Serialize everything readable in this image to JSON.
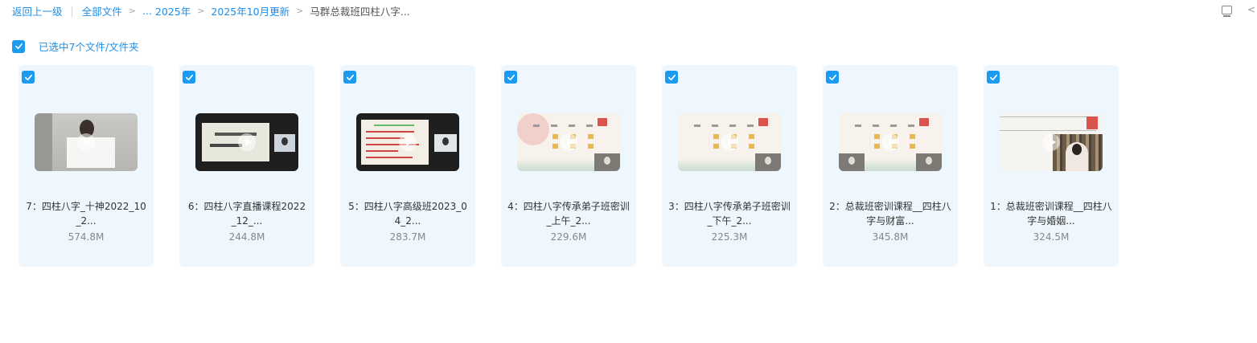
{
  "breadcrumb": {
    "back": "返回上一级",
    "all_files": "全部文件",
    "ellipsis": "...",
    "year": "2025年",
    "month": "2025年10月更新",
    "current": "马群总裁班四柱八字..."
  },
  "selection": {
    "label": "已选中7个文件/文件夹",
    "checked": true
  },
  "accent_color": "#1a9bef",
  "files": [
    {
      "name": "7：四柱八字_十神2022_10_2...",
      "size": "574.8M",
      "thumb": "person-whiteboard"
    },
    {
      "name": "6：四柱八字直播课程2022_12_...",
      "size": "244.8M",
      "thumb": "dark-slide"
    },
    {
      "name": "5：四柱八字高级班2023_04_2...",
      "size": "283.7M",
      "thumb": "notes-slide"
    },
    {
      "name": "4：四柱八字传承弟子班密训_上午_2...",
      "size": "229.6M",
      "thumb": "chart-slide"
    },
    {
      "name": "3：四柱八字传承弟子班密训_下午_2...",
      "size": "225.3M",
      "thumb": "chart-slide"
    },
    {
      "name": "2：总裁班密训课程__四柱八字与财富...",
      "size": "345.8M",
      "thumb": "chart-slide"
    },
    {
      "name": "1：总裁班密训课程__四柱八字与婚姻...",
      "size": "324.5M",
      "thumb": "bookshelf"
    }
  ]
}
